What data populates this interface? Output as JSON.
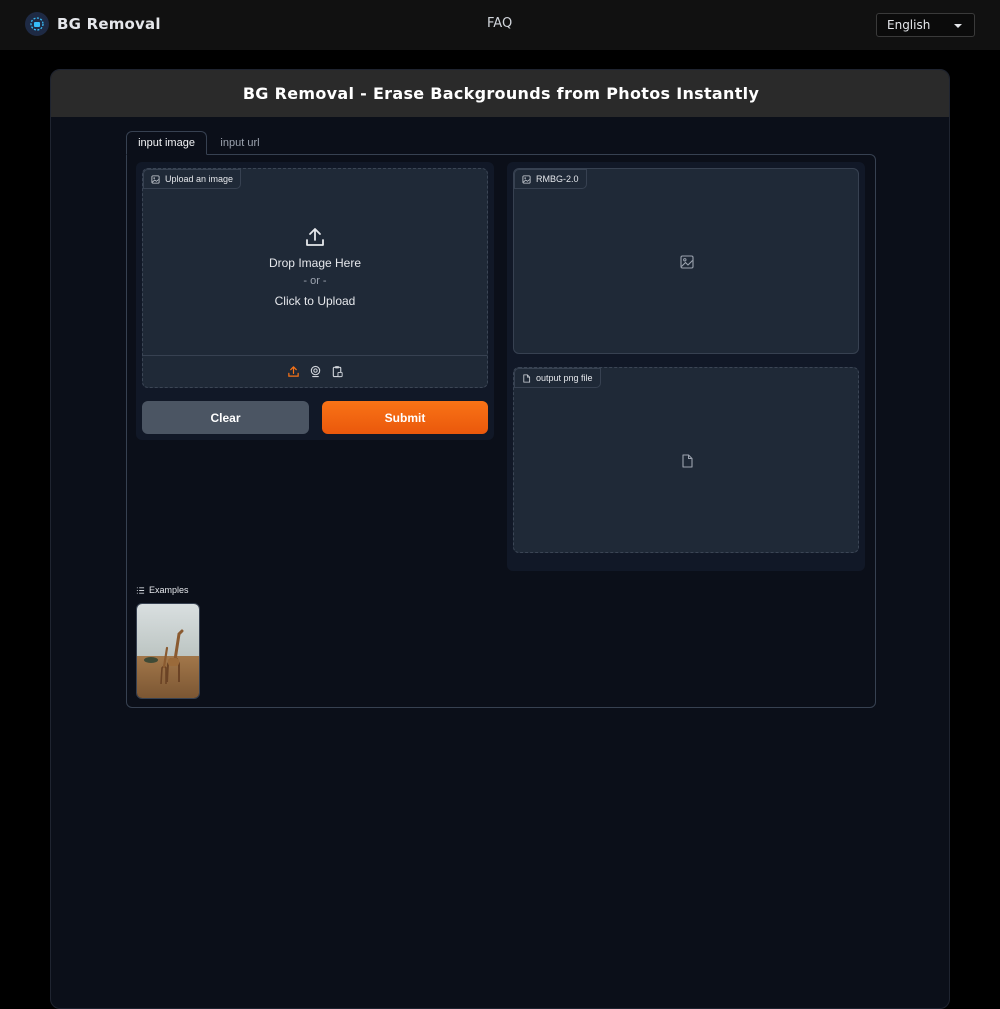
{
  "nav": {
    "brand": "BG Removal",
    "faq": "FAQ",
    "language": "English"
  },
  "main": {
    "title": "BG Removal - Erase Backgrounds from Photos Instantly",
    "tabs": [
      {
        "label": "input image",
        "active": true
      },
      {
        "label": "input url",
        "active": false
      }
    ],
    "upload": {
      "label": "Upload an image",
      "drop": "Drop Image Here",
      "or": "- or -",
      "click": "Click to Upload"
    },
    "buttons": {
      "clear": "Clear",
      "submit": "Submit"
    },
    "output_image_label": "RMBG-2.0",
    "output_file_label": "output png file",
    "examples_label": "Examples"
  },
  "colors": {
    "accent": "#f97316",
    "clear_button": "#4b5563",
    "panel_bg": "#0b0f19"
  },
  "icons": [
    "upload-icon",
    "webcam-icon",
    "clipboard-icon",
    "image-icon",
    "file-icon",
    "list-icon",
    "caret-down-icon"
  ]
}
